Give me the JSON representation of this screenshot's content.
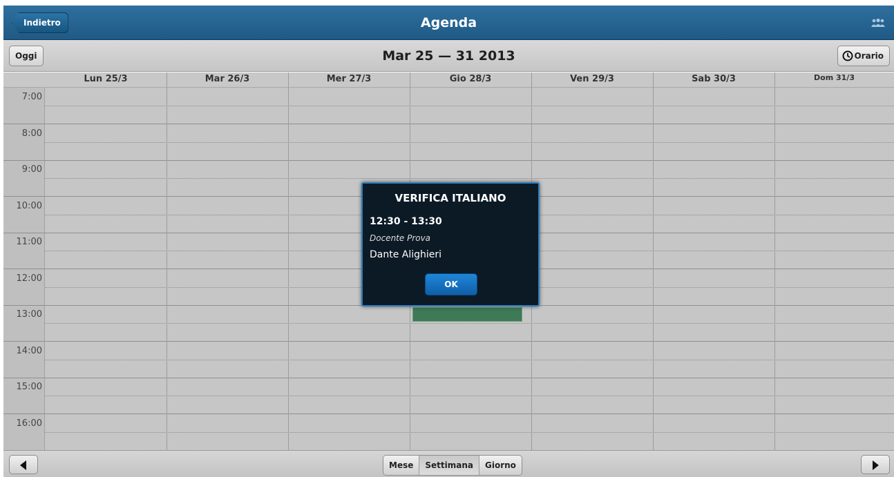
{
  "header": {
    "back_label": "Indietro",
    "title": "Agenda",
    "users_icon": "users-icon"
  },
  "toolbar": {
    "today_label": "Oggi",
    "range_title": "Mar 25 — 31 2013",
    "schedule_label": "Orario",
    "schedule_icon": "clock-icon"
  },
  "calendar": {
    "days": [
      "Lun 25/3",
      "Mar 26/3",
      "Mer 27/3",
      "Gio 28/3",
      "Ven 29/3",
      "Sab 30/3",
      "Dom 31/3"
    ],
    "hours": [
      "7:00",
      "8:00",
      "9:00",
      "10:00",
      "11:00",
      "12:00",
      "13:00",
      "14:00",
      "15:00",
      "16:00"
    ],
    "event_color": "#3d7a55"
  },
  "dialog": {
    "title": "VERIFICA ITALIANO",
    "time": "12:30 - 13:30",
    "teacher": "Docente Prova",
    "name": "Dante Alighieri",
    "ok_label": "OK",
    "border_color": "#2a7fbf"
  },
  "footer": {
    "prev_icon": "arrow-left-icon",
    "next_icon": "arrow-right-icon",
    "views": [
      "Mese",
      "Settimana",
      "Giorno"
    ],
    "active_view": "Settimana"
  }
}
